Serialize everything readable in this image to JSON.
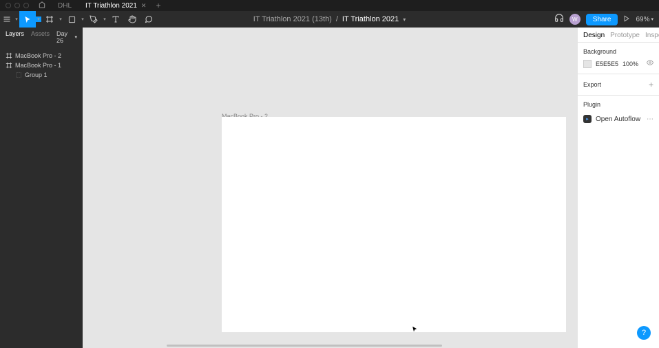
{
  "titlebar": {
    "tab_dhl": "DHL",
    "tab_active": "IT Triathlon 2021"
  },
  "toolbar": {
    "breadcrumb_project": "IT Triathlon 2021 (13th)",
    "breadcrumb_sep": "/",
    "breadcrumb_current": "IT Triathlon 2021",
    "avatar_initials": "W",
    "share_label": "Share",
    "zoom": "69%"
  },
  "left_panel": {
    "tab_layers": "Layers",
    "tab_assets": "Assets",
    "page_label": "Day 26",
    "layers": [
      {
        "name": "MacBook Pro - 2",
        "type": "frame"
      },
      {
        "name": "MacBook Pro - 1",
        "type": "frame"
      },
      {
        "name": "Group 1",
        "type": "group",
        "indent": true
      }
    ]
  },
  "canvas": {
    "frame_label": "MacBook Pro - 2"
  },
  "right_panel": {
    "tab_design": "Design",
    "tab_prototype": "Prototype",
    "tab_inspect": "Inspect",
    "background_title": "Background",
    "background_hex": "E5E5E5",
    "background_opacity": "100%",
    "export_title": "Export",
    "plugin_title": "Plugin",
    "plugin_name": "Open Autoflow"
  }
}
